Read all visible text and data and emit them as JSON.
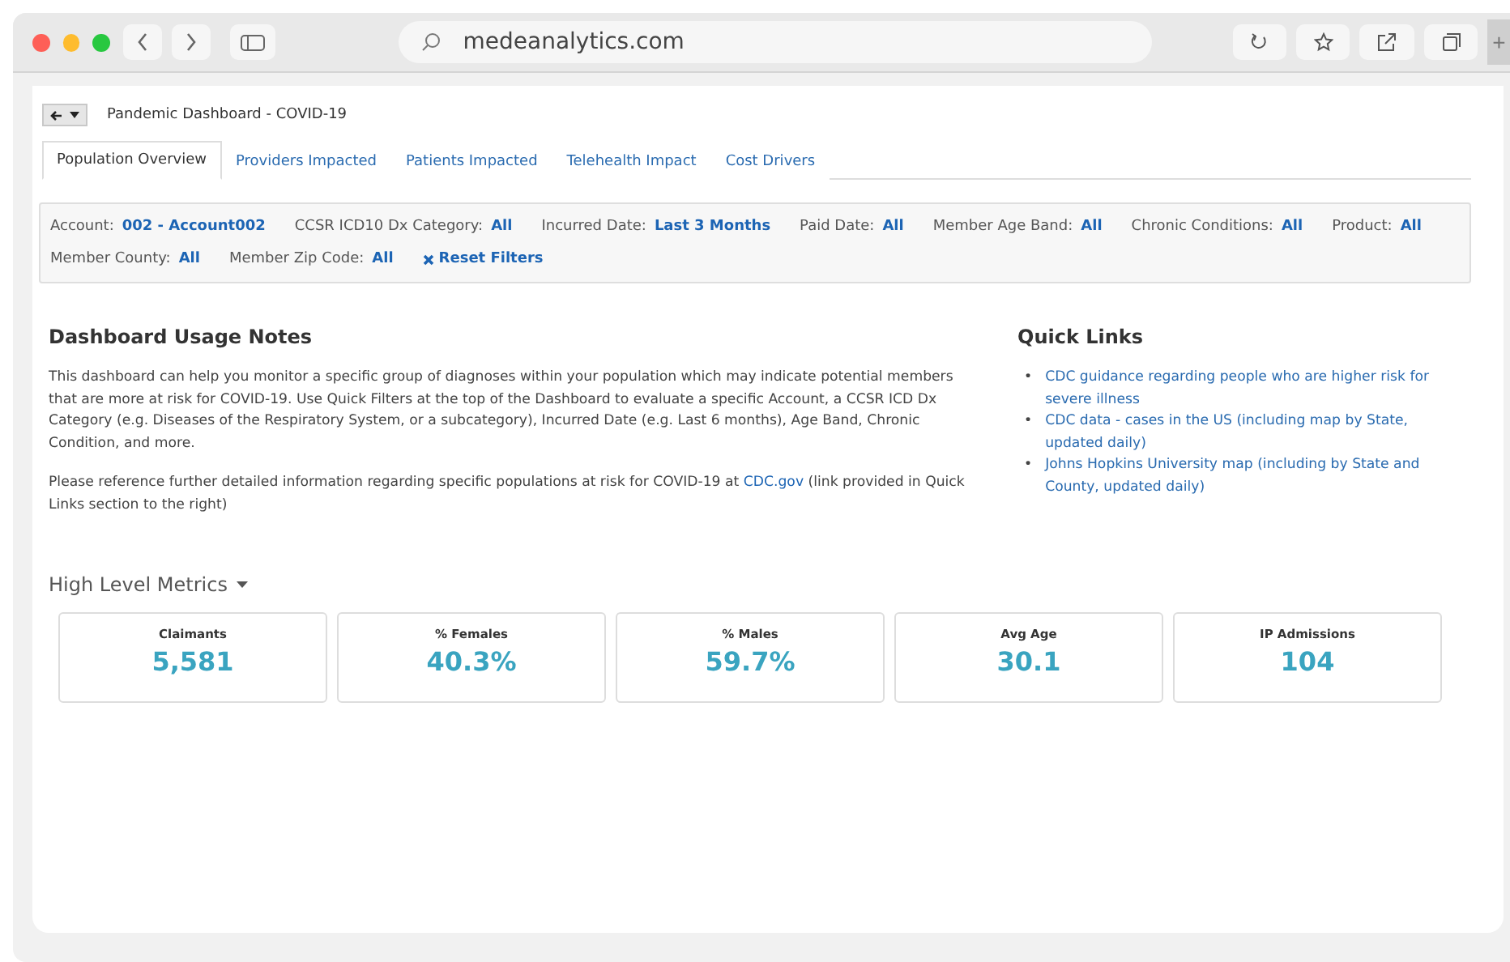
{
  "browser": {
    "url": "medeanalytics.com",
    "new_tab": "+"
  },
  "dashboard": {
    "title": "Pandemic Dashboard - COVID-19"
  },
  "tabs": [
    {
      "label": "Population Overview",
      "selected": true
    },
    {
      "label": "Providers Impacted",
      "selected": false
    },
    {
      "label": "Patients Impacted",
      "selected": false
    },
    {
      "label": "Telehealth Impact",
      "selected": false
    },
    {
      "label": "Cost Drivers",
      "selected": false
    }
  ],
  "filters": [
    {
      "label": "Account:",
      "value": "002 - Account002"
    },
    {
      "label": "CCSR ICD10 Dx Category:",
      "value": "All"
    },
    {
      "label": "Incurred Date:",
      "value": "Last 3 Months"
    },
    {
      "label": "Paid Date:",
      "value": "All"
    },
    {
      "label": "Member Age Band:",
      "value": "All"
    },
    {
      "label": "Chronic Conditions:",
      "value": "All"
    },
    {
      "label": "Product:",
      "value": "All"
    },
    {
      "label": "Member County:",
      "value": "All"
    },
    {
      "label": "Member Zip Code:",
      "value": "All"
    }
  ],
  "reset_filters": "Reset Filters",
  "usage_notes": {
    "title": "Dashboard Usage Notes",
    "paragraph_1": "This dashboard can help you monitor a specific group of diagnoses within your population which may indicate  potential members that are more at risk for COVID-19. Use Quick Filters at the top of the Dashboard to evaluate a specific Account, a CCSR ICD Dx Category (e.g. Diseases of the Respiratory System, or a subcategory), Incurred Date (e.g. Last 6 months), Age Band, Chronic Condition, and more.",
    "paragraph_2_before": "Please reference further detailed information regarding specific populations at risk for COVID-19 at",
    "paragraph_2_link": "CDC.gov",
    "paragraph_2_after": "(link provided in Quick Links section to the right)"
  },
  "quick_links": {
    "title": "Quick Links",
    "items": [
      {
        "bullet": "•",
        "text": "CDC guidance regarding people who are higher risk for severe illness"
      },
      {
        "bullet": "•",
        "text": "CDC data - cases in the US (including map by State, updated daily)"
      },
      {
        "bullet": "•",
        "text": "Johns Hopkins University map (including by State and County, updated daily)"
      }
    ]
  },
  "metrics": {
    "title": "High Level Metrics",
    "cards": [
      {
        "label": "Claimants",
        "value": "5,581"
      },
      {
        "label": "% Females",
        "value": "40.3%"
      },
      {
        "label": "% Males",
        "value": "59.7%"
      },
      {
        "label": "Avg Age",
        "value": "30.1"
      },
      {
        "label": "IP Admissions",
        "value": "104"
      }
    ]
  }
}
